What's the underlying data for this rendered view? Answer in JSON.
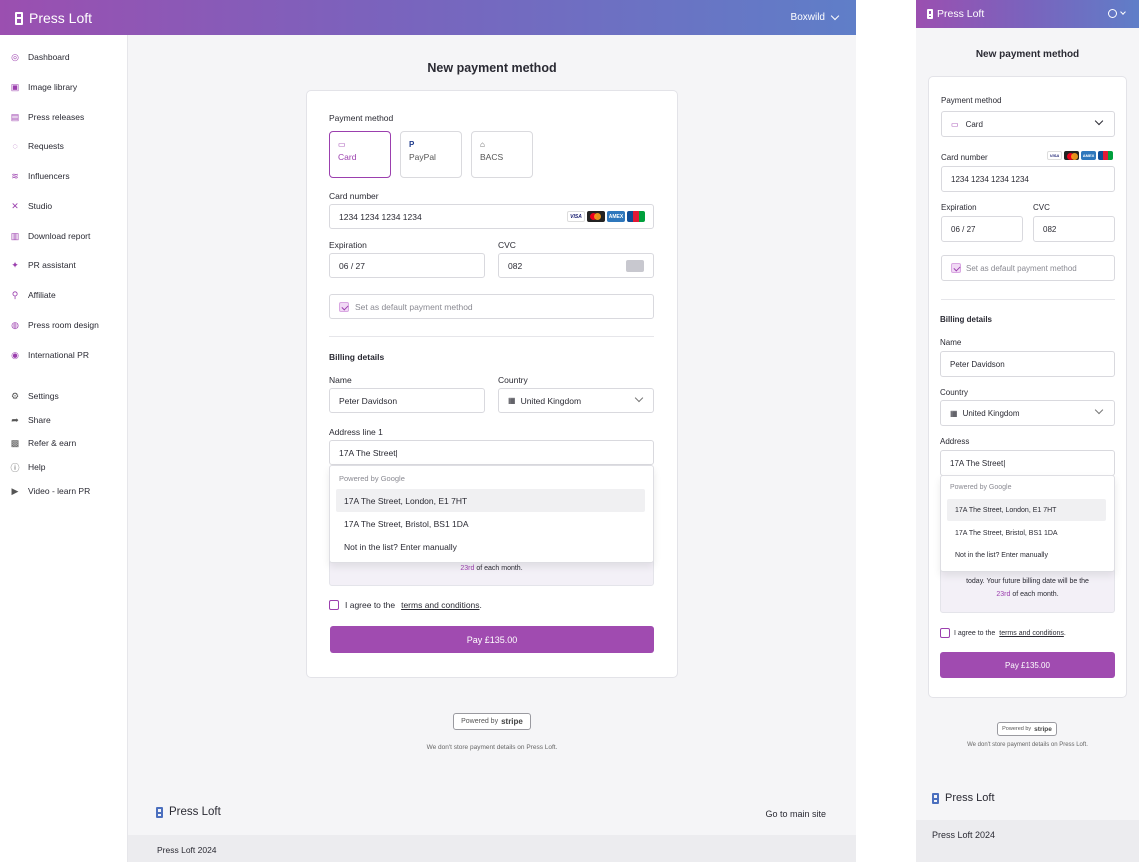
{
  "app": {
    "name": "Press Loft",
    "account": "Boxwild"
  },
  "colors": {
    "accent": "#9b3fae",
    "gradient_start": "#9b4fb0",
    "gradient_end": "#5f7ec8"
  },
  "sidebar": {
    "items": [
      {
        "label": "Dashboard",
        "icon": "dashboard-icon"
      },
      {
        "label": "Image library",
        "icon": "image-icon"
      },
      {
        "label": "Press releases",
        "icon": "document-icon"
      },
      {
        "label": "Requests",
        "icon": "chat-icon"
      },
      {
        "label": "Influencers",
        "icon": "megaphone-icon"
      },
      {
        "label": "Studio",
        "icon": "studio-icon"
      },
      {
        "label": "Download report",
        "icon": "chart-icon"
      },
      {
        "label": "PR assistant",
        "icon": "sparkle-icon"
      },
      {
        "label": "Affiliate",
        "icon": "link-icon"
      },
      {
        "label": "Press room design",
        "icon": "palette-icon"
      },
      {
        "label": "International PR",
        "icon": "globe-icon"
      }
    ],
    "secondary": [
      {
        "label": "Settings",
        "icon": "gear-icon"
      },
      {
        "label": "Share",
        "icon": "share-icon"
      },
      {
        "label": "Refer & earn",
        "icon": "gift-icon"
      },
      {
        "label": "Help",
        "icon": "help-icon"
      },
      {
        "label": "Video - learn PR",
        "icon": "play-icon"
      }
    ]
  },
  "form": {
    "title": "New payment method",
    "payment_method_label": "Payment method",
    "methods": [
      {
        "label": "Card",
        "icon": "card-icon",
        "selected": true
      },
      {
        "label": "PayPal",
        "icon": "paypal-icon",
        "selected": false
      },
      {
        "label": "BACS",
        "icon": "bank-icon",
        "selected": false
      }
    ],
    "card_number_label": "Card number",
    "card_number": "1234 1234 1234 1234",
    "card_brands": [
      "VISA",
      "mastercard",
      "AMEX",
      "JCB"
    ],
    "expiration_label": "Expiration",
    "expiration": "06 / 27",
    "cvc_label": "CVC",
    "cvc": "082",
    "default_label": "Set as default payment method",
    "default_checked": true,
    "billing_heading": "Billing details",
    "name_label": "Name",
    "name": "Peter Davidson",
    "country_label": "Country",
    "country": "United Kingdom",
    "address_label": "Address line 1",
    "address_label_mobile": "Address",
    "address": "17A The Street|",
    "autocomplete": {
      "caption": "Powered by Google",
      "options": [
        "17A The Street, London, E1 7HT",
        "17A The Street, Bristol, BS1 1DA",
        "Not in the list? Enter manually"
      ]
    },
    "billing_note_prefix": "today. Your future billing date will be the",
    "billing_date": "23rd",
    "billing_note_suffix": "of each month.",
    "agree_prefix": "I agree to the",
    "agree_link": "terms and conditions",
    "agree_suffix": ".",
    "pay_label": "Pay £135.00"
  },
  "stripe": {
    "powered": "Powered by",
    "brand": "stripe",
    "note": "We don't store payment details on Press Loft."
  },
  "footer": {
    "logo": "Press Loft",
    "main_site": "Go to main site",
    "copyright": "Press Loft 2024"
  }
}
